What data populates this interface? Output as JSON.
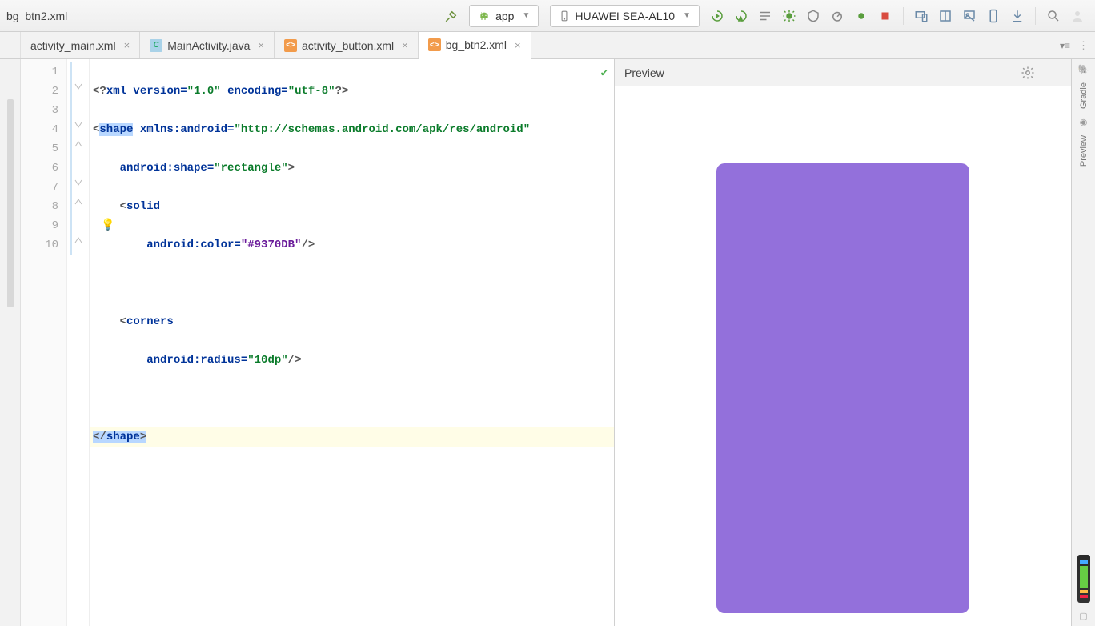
{
  "header": {
    "breadcrumb": "bg_btn2.xml",
    "app_dropdown": "app",
    "device_dropdown": "HUAWEI SEA-AL10"
  },
  "tabs": [
    {
      "label": "activity_main.xml",
      "icon": "xml",
      "active": false
    },
    {
      "label": "MainActivity.java",
      "icon": "java",
      "active": false
    },
    {
      "label": "activity_button.xml",
      "icon": "xml",
      "active": false
    },
    {
      "label": "bg_btn2.xml",
      "icon": "xml",
      "active": true
    }
  ],
  "preview": {
    "title": "Preview",
    "shape_color": "#9370DB",
    "shape_radius": "10px"
  },
  "rightRail": {
    "labels": [
      "Gradle",
      "Preview"
    ]
  },
  "editor": {
    "line_numbers": [
      "1",
      "2",
      "3",
      "4",
      "5",
      "6",
      "7",
      "8",
      "9",
      "10"
    ],
    "tokens": {
      "l1_a": "<?",
      "l1_b": "xml",
      "l1_c": " version=",
      "l1_d": "\"1.0\"",
      "l1_e": " encoding=",
      "l1_f": "\"utf-8\"",
      "l1_g": "?>",
      "l2_a": "<",
      "l2_b": "shape",
      "l2_c": " xmlns:android=",
      "l2_d": "\"http://schemas.android.com/apk/res/android\"",
      "l3_a": "android:shape=",
      "l3_b": "\"rectangle\"",
      "l3_c": ">",
      "l4_a": "<",
      "l4_b": "solid",
      "l5_a": "android:color=",
      "l5_b": "\"#9370DB\"",
      "l5_c": "/>",
      "l7_a": "<",
      "l7_b": "corners",
      "l8_a": "android:radius=",
      "l8_b": "\"10dp\"",
      "l8_c": "/>",
      "l10_a": "</",
      "l10_b": "shape",
      "l10_c": ">"
    }
  }
}
